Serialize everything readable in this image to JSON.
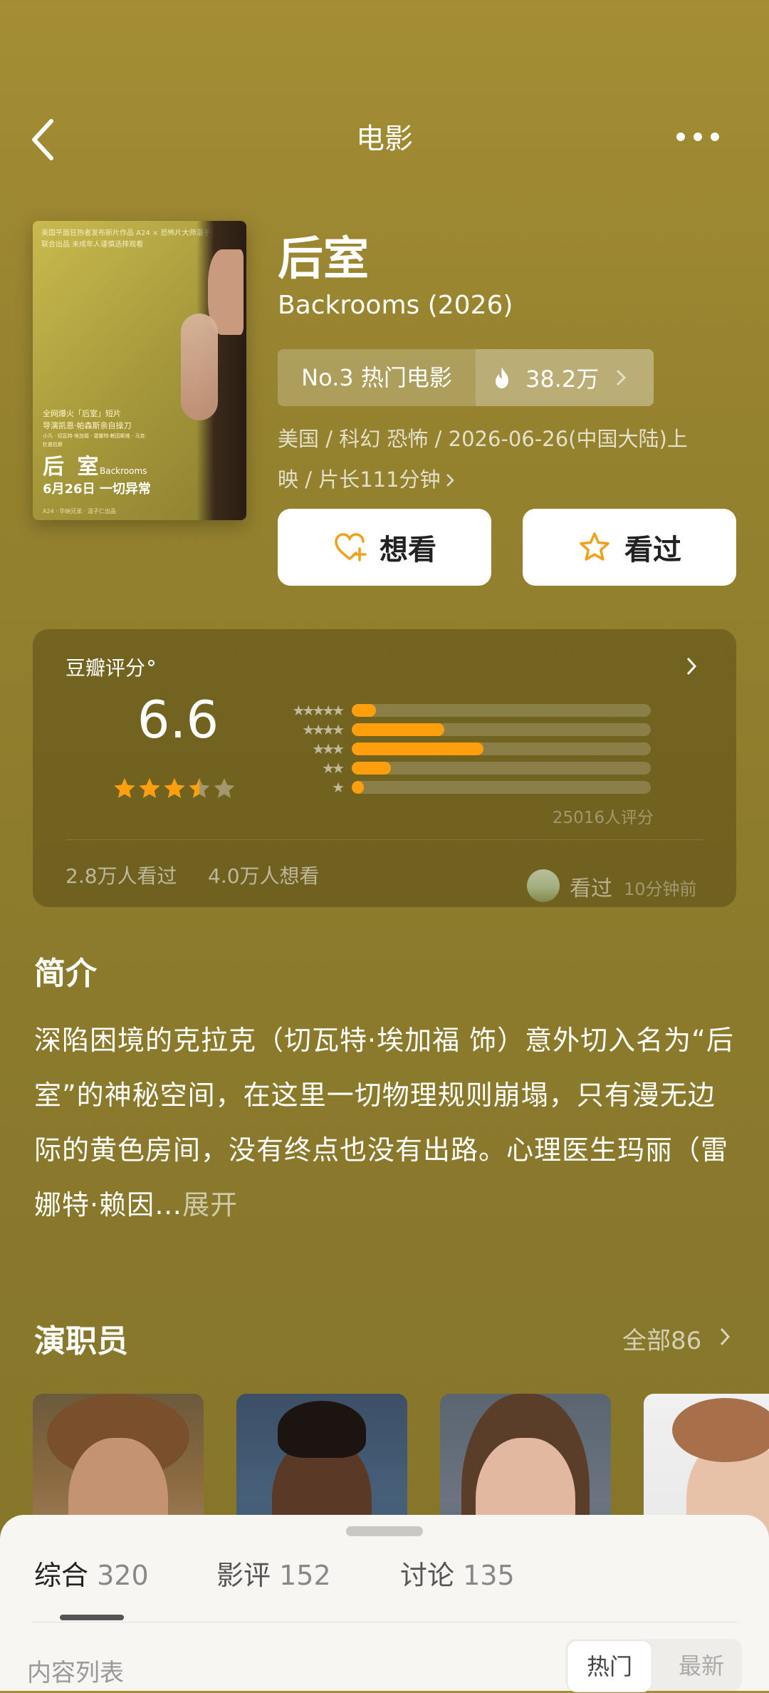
{
  "header": {
    "title": "电影"
  },
  "poster": {
    "top_text": "美国平面狂热者发布新片作品 A24 × 恐怖片大师温子仁 联合出品 未成年人谨慎选择观看",
    "promo_line1": "全网爆火「后室」短片",
    "promo_line2": "导演凯恩·帕森斯亲自操刀",
    "credits": "小凡 · 切瓦特·埃加福 · 雷娜特·赖因斯维 · 马克·杜普拉斯",
    "title_cn": "后 室",
    "title_en": "Backrooms",
    "release": "6月26日 一切异常",
    "footer": "A24 · 华纳兄弟 · 温子仁出品"
  },
  "movie": {
    "title_cn": "后室",
    "title_en": "Backrooms (2026)",
    "rank_label": "No.3 热门电影",
    "heat": "38.2万",
    "meta_line1": "美国 / 科幻 恐怖 / 2026-06-26(中国大陆)上",
    "meta_line2": "映 / 片长111分钟"
  },
  "actions": {
    "want_label": "想看",
    "seen_label": "看过"
  },
  "rating": {
    "label": "豆瓣评分",
    "score": "6.6",
    "stars": 3.5,
    "distribution": [
      {
        "stars": "★★★★★",
        "fraction": 0.08
      },
      {
        "stars": "★★★★",
        "fraction": 0.31
      },
      {
        "stars": "★★★",
        "fraction": 0.44
      },
      {
        "stars": "★★",
        "fraction": 0.13
      },
      {
        "stars": "★",
        "fraction": 0.04
      }
    ],
    "count": "25016人评分",
    "watched": "2.8万人看过",
    "want": "4.0万人想看",
    "my_status": "看过",
    "my_time": "10分钟前"
  },
  "intro": {
    "heading": "简介",
    "text": "深陷困境的克拉克（切瓦特·埃加福 饰）意外切入名为“后室”的神秘空间，在这里一切物理规则崩塌，只有漫无边际的黄色房间，没有终点也没有出路。心理医生玛丽（雷娜特·赖因…",
    "expand": "展开"
  },
  "cast": {
    "heading": "演职员",
    "all_label": "全部86"
  },
  "sheet": {
    "tabs": [
      {
        "label": "综合",
        "count": "320"
      },
      {
        "label": "影评",
        "count": "152"
      },
      {
        "label": "讨论",
        "count": "135"
      }
    ],
    "content_label": "内容列表",
    "sort_hot": "热门",
    "sort_new": "最新"
  },
  "colors": {
    "accent": "#ff9f0e",
    "bg": "#95822f",
    "sheet": "#f7f6f3"
  }
}
